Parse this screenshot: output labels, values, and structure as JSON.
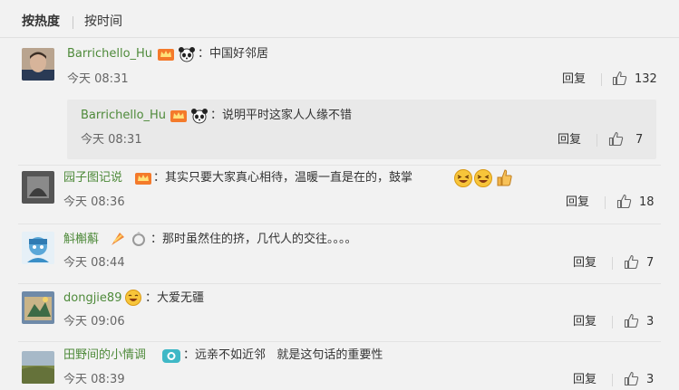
{
  "tabs": {
    "active": "按热度",
    "other": "按时间"
  },
  "comments": [
    {
      "user": "Barrichello_Hu",
      "text": "：中国好邻居",
      "time": "今天 08:31",
      "reply": "回复",
      "likes": "132"
    },
    {
      "user": "Barrichello_Hu",
      "text": "：说明平时这家人人缘不错",
      "time": "今天 08:31",
      "reply": "回复",
      "likes": "7"
    },
    {
      "user": "园子图记说",
      "text": "：其实只要大家真心相待，温暖一直是在的，鼓掌",
      "time": "今天 08:36",
      "reply": "回复",
      "likes": "18"
    },
    {
      "user": "斛槲蔛",
      "text": "：那时虽然住的挤，几代人的交往。。。。",
      "time": "今天 08:44",
      "reply": "回复",
      "likes": "7"
    },
    {
      "user": "dongjie89",
      "text": "：大爱无疆",
      "time": "今天 09:06",
      "reply": "回复",
      "likes": "3"
    },
    {
      "user": "田野间的小情调",
      "text": "：远亲不如近邻   就是这句话的重要性",
      "time": "今天 08:39",
      "reply": "回复",
      "likes": "3"
    }
  ],
  "icons": {
    "like": "thumbs-up-icon",
    "badge": "member-crown-icon",
    "panda": "panda-icon",
    "camera": "camera-badge-icon",
    "laugh": "laughing-emoji-icon",
    "clap": "clapping-emoji-icon",
    "ring": "ring-badge-icon",
    "flag": "flag-badge-icon"
  },
  "colors": {
    "username": "#4e8a3a",
    "background": "#f2f2f2",
    "nested_background": "#e9e9e9"
  }
}
